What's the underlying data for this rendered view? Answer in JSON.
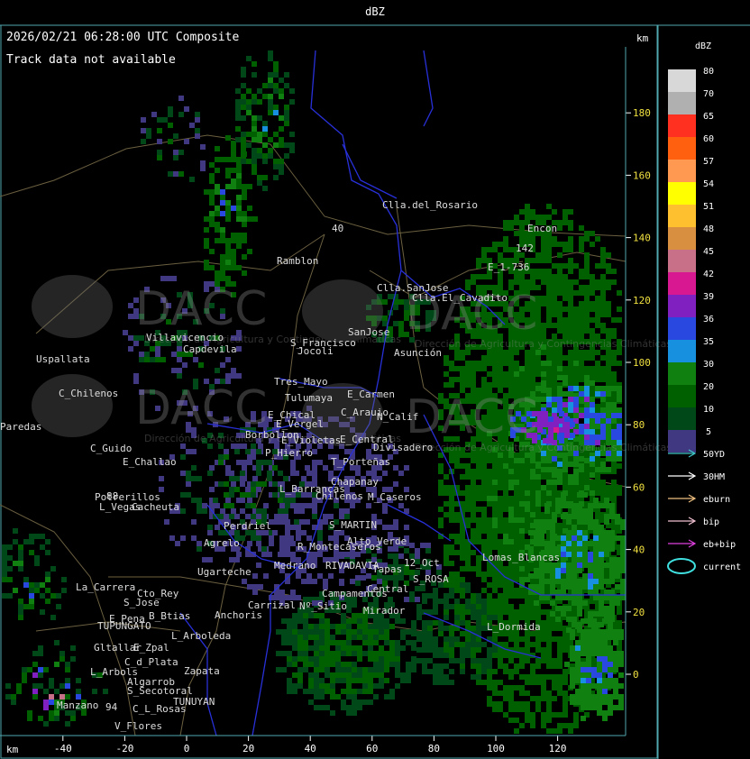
{
  "header": {
    "title": "dBZ",
    "timestamp": "2026/02/21 06:28:00 UTC Composite",
    "track_message": "Track data not available",
    "unit_right": "km",
    "unit_bottom": "km"
  },
  "axes": {
    "x_ticks": [
      "-40",
      "-20",
      "0",
      "20",
      "40",
      "60",
      "80",
      "100",
      "120"
    ],
    "y_ticks": [
      "180",
      "160",
      "140",
      "120",
      "100",
      "80",
      "60",
      "40",
      "20",
      "0"
    ]
  },
  "legend": {
    "title": "dBZ",
    "levels": [
      {
        "label": "80",
        "color": "#d8d8d8"
      },
      {
        "label": "70",
        "color": "#b0b0b0"
      },
      {
        "label": "65",
        "color": "#ff3020"
      },
      {
        "label": "60",
        "color": "#ff6010"
      },
      {
        "label": "57",
        "color": "#ff9850"
      },
      {
        "label": "54",
        "color": "#ffff00"
      },
      {
        "label": "51",
        "color": "#ffc030"
      },
      {
        "label": "48",
        "color": "#d89040"
      },
      {
        "label": "45",
        "color": "#c87088"
      },
      {
        "label": "42",
        "color": "#d81890"
      },
      {
        "label": "39",
        "color": "#8020c0"
      },
      {
        "label": "36",
        "color": "#2848e0"
      },
      {
        "label": "35",
        "color": "#1890e0"
      },
      {
        "label": "30",
        "color": "#108010"
      },
      {
        "label": "20",
        "color": "#006000"
      },
      {
        "label": "10",
        "color": "#004818"
      },
      {
        "label": "5",
        "color": "#403880"
      }
    ],
    "tracks": [
      {
        "label": "50YD",
        "color": "#40c8c8"
      },
      {
        "label": "30HM",
        "color": "#ffffff"
      },
      {
        "label": "eburn",
        "color": "#f0c080"
      },
      {
        "label": "bip",
        "color": "#f0c0d0"
      },
      {
        "label": "eb+bip",
        "color": "#e040e0"
      },
      {
        "label": "current",
        "color": "#40e0e0"
      }
    ]
  },
  "watermark": {
    "text": "DACC",
    "subtitle": "Dirección de Agricultura y Contingencias Climáticas"
  },
  "places": [
    {
      "name": "Clla.del_Rosario"
    },
    {
      "name": "Encon"
    },
    {
      "name": "E_1-736"
    },
    {
      "name": "Ramblon"
    },
    {
      "name": "Clla.SanJose"
    },
    {
      "name": "Clla.El_Cavadito"
    },
    {
      "name": "Villavicencio"
    },
    {
      "name": "Uspallata"
    },
    {
      "name": "Capdevila"
    },
    {
      "name": "S_Francisco"
    },
    {
      "name": "Jocoli"
    },
    {
      "name": "SanJose"
    },
    {
      "name": "Asunción"
    },
    {
      "name": "Tres_Mayo"
    },
    {
      "name": "Tulumaya"
    },
    {
      "name": "E_Carmen"
    },
    {
      "name": "C_Chilenos"
    },
    {
      "name": "C_Arauio"
    },
    {
      "name": "E_Chical"
    },
    {
      "name": "E_Vergel"
    },
    {
      "name": "N_Calif"
    },
    {
      "name": "Paredas"
    },
    {
      "name": "Borbollon"
    },
    {
      "name": "E_Violetas"
    },
    {
      "name": "E_Central"
    },
    {
      "name": "Divisadero"
    },
    {
      "name": "C_Guido"
    },
    {
      "name": "E_Challao"
    },
    {
      "name": "P_Hierro"
    },
    {
      "name": "T_Porteñas"
    },
    {
      "name": "L_Barrancas"
    },
    {
      "name": "Chapanay"
    },
    {
      "name": "Potrerillos"
    },
    {
      "name": "Chilenos"
    },
    {
      "name": "M_Caseros"
    },
    {
      "name": "L_Vegas"
    },
    {
      "name": "Cacheuta"
    },
    {
      "name": "Perdriel"
    },
    {
      "name": "S_MARTIN"
    },
    {
      "name": "Agrelo"
    },
    {
      "name": "R_Montecaseros"
    },
    {
      "name": "Alto_Verde"
    },
    {
      "name": "12_Oct"
    },
    {
      "name": "Ugarteche"
    },
    {
      "name": "Medrano"
    },
    {
      "name": "RIVADAVIA"
    },
    {
      "name": "Tapas"
    },
    {
      "name": "Lomas_Blancas"
    },
    {
      "name": "La_Carrera"
    },
    {
      "name": "Cto_Rey"
    },
    {
      "name": "S_ROSA"
    },
    {
      "name": "S_Jose"
    },
    {
      "name": "Campamentos"
    },
    {
      "name": "Central"
    },
    {
      "name": "Anchoris"
    },
    {
      "name": "E_Pena"
    },
    {
      "name": "B_Btias"
    },
    {
      "name": "Carrizal"
    },
    {
      "name": "Nº_Sitio"
    },
    {
      "name": "TUPUNGATO"
    },
    {
      "name": "L_Arboleda"
    },
    {
      "name": "Mirador"
    },
    {
      "name": "L_Dormida"
    },
    {
      "name": "Gltallar"
    },
    {
      "name": "E_Zpal"
    },
    {
      "name": "C_d_Plata"
    },
    {
      "name": "L_Arbols"
    },
    {
      "name": "Algarrob"
    },
    {
      "name": "Zapata"
    },
    {
      "name": "S_Secotoral"
    },
    {
      "name": "TUNUYAN"
    },
    {
      "name": "Manzano"
    },
    {
      "name": "C_L_Rosas"
    },
    {
      "name": "V_Flores"
    },
    {
      "name": "142"
    },
    {
      "name": "40"
    },
    {
      "name": "88"
    },
    {
      "name": "94"
    }
  ]
}
